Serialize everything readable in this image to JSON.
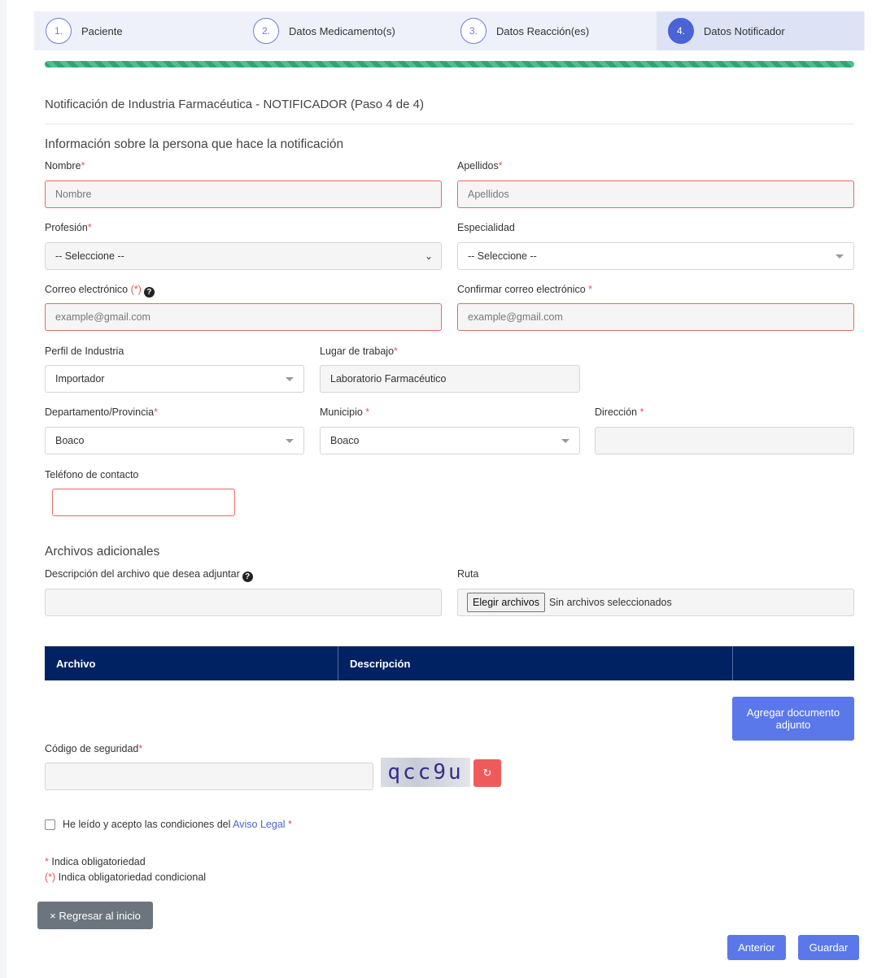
{
  "steps": [
    {
      "num": "1.",
      "label": "Paciente"
    },
    {
      "num": "2.",
      "label": "Datos Medicamento(s)"
    },
    {
      "num": "3.",
      "label": "Datos Reacción(es)"
    },
    {
      "num": "4.",
      "label": "Datos Notificador",
      "active": true
    }
  ],
  "form_title": "Notificación de Industria Farmacéutica - NOTIFICADOR (Paso 4 de 4)",
  "section_person": "Información sobre la persona que hace la notificación",
  "fields": {
    "nombre": {
      "label": "Nombre",
      "req": "*",
      "placeholder": "Nombre"
    },
    "apellidos": {
      "label": "Apellidos",
      "req": "*",
      "placeholder": "Apellidos"
    },
    "profesion": {
      "label": "Profesión",
      "req": "*",
      "value": "-- Seleccione --"
    },
    "especialidad": {
      "label": "Especialidad",
      "value": "-- Seleccione --"
    },
    "correo": {
      "label": "Correo electrónico",
      "req": "(*)",
      "placeholder": "example@gmail.com"
    },
    "confirmar_correo": {
      "label": "Confirmar correo electrónico",
      "req": " *",
      "placeholder": "example@gmail.com"
    },
    "perfil": {
      "label": "Perfil de Industria",
      "value": "Importador"
    },
    "lugar": {
      "label": "Lugar de trabajo",
      "req": "*",
      "value": "Laboratorio Farmacéutico"
    },
    "departamento": {
      "label": "Departamento/Provincia",
      "req": "*",
      "value": "Boaco"
    },
    "municipio": {
      "label": "Municipio",
      "req": " *",
      "value": "Boaco"
    },
    "direccion": {
      "label": "Dirección",
      "req": " *"
    },
    "telefono": {
      "label": "Teléfono de contacto"
    }
  },
  "section_files": "Archivos adicionales",
  "files": {
    "desc_label": "Descripción del archivo que desea adjuntar",
    "ruta_label": "Ruta",
    "choose_button": "Elegir archivos",
    "no_files": "Sin archivos seleccionados"
  },
  "table": {
    "headers": [
      "Archivo",
      "Descripción",
      ""
    ]
  },
  "add_doc_button": "Agregar documento adjunto",
  "security": {
    "label": "Código de seguridad",
    "req": "*",
    "captcha_text": "qcc9u",
    "refresh_icon": "↻"
  },
  "legal": {
    "text": "He leído y acepto las condiciones del ",
    "link": "Aviso Legal",
    "req": " *"
  },
  "notes": {
    "req1": "*",
    "note1": " Indica obligatoriedad",
    "req2": "(*)",
    "note2": " Indica obligatoriedad condicional"
  },
  "buttons": {
    "back_home": "× Regresar al inicio",
    "previous": "Anterior",
    "save": "Guardar"
  },
  "colors": {
    "primary": "#5b78ea",
    "table_header": "#012262",
    "required": "#e35757",
    "progress": "#2aa873"
  }
}
